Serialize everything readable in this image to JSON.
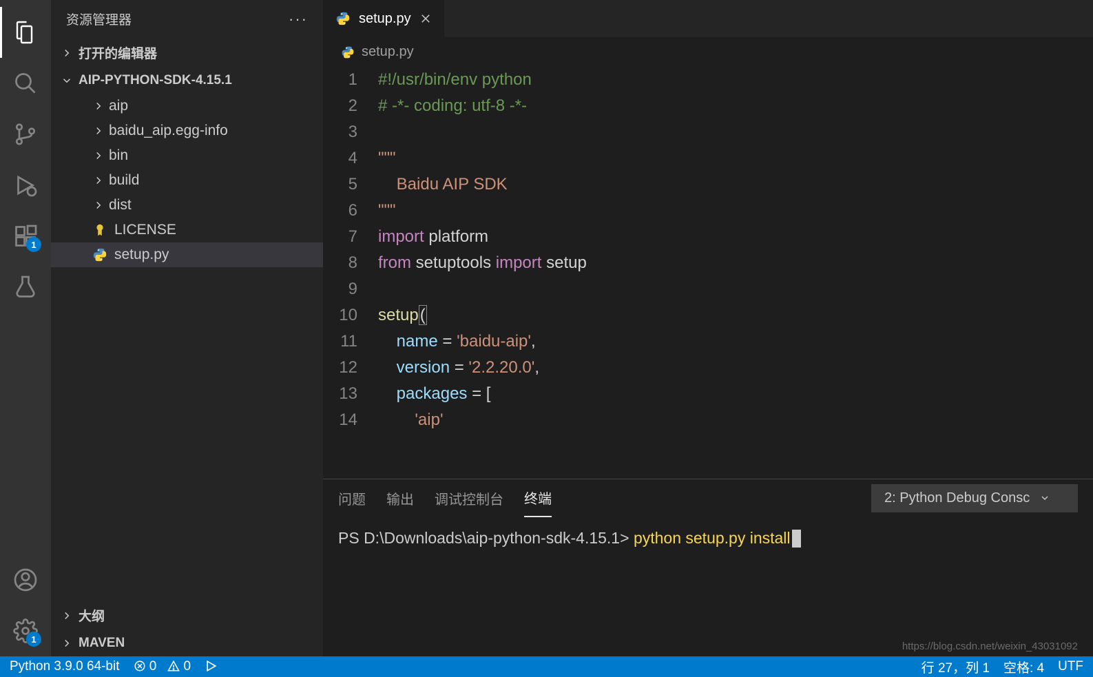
{
  "sidebar": {
    "title": "资源管理器",
    "sections": {
      "open_editors": "打开的编辑器",
      "project": "AIP-PYTHON-SDK-4.15.1",
      "outline": "大纲",
      "maven": "MAVEN"
    },
    "tree": {
      "folders": [
        "aip",
        "baidu_aip.egg-info",
        "bin",
        "build",
        "dist"
      ],
      "files": [
        {
          "name": "LICENSE",
          "icon": "license"
        },
        {
          "name": "setup.py",
          "icon": "python",
          "selected": true
        }
      ]
    }
  },
  "activity": {
    "ext_badge": "1",
    "settings_badge": "1"
  },
  "tab": {
    "name": "setup.py"
  },
  "breadcrumb": {
    "name": "setup.py"
  },
  "code": {
    "lines": [
      {
        "n": 1,
        "segs": [
          [
            "c-comment",
            "#!/usr/bin/env python"
          ]
        ]
      },
      {
        "n": 2,
        "segs": [
          [
            "c-comment",
            "# -*- coding: utf-8 -*-"
          ]
        ]
      },
      {
        "n": 3,
        "segs": []
      },
      {
        "n": 4,
        "segs": [
          [
            "c-str",
            "\"\"\""
          ]
        ]
      },
      {
        "n": 5,
        "segs": [
          [
            "c-plain",
            "    "
          ],
          [
            "c-str",
            "Baidu AIP SDK"
          ]
        ]
      },
      {
        "n": 6,
        "segs": [
          [
            "c-str",
            "\"\"\""
          ]
        ]
      },
      {
        "n": 7,
        "segs": [
          [
            "c-kw",
            "import"
          ],
          [
            "c-plain",
            " platform"
          ]
        ]
      },
      {
        "n": 8,
        "segs": [
          [
            "c-kw",
            "from"
          ],
          [
            "c-plain",
            " setuptools "
          ],
          [
            "c-kw",
            "import"
          ],
          [
            "c-plain",
            " setup"
          ]
        ]
      },
      {
        "n": 9,
        "segs": []
      },
      {
        "n": 10,
        "segs": [
          [
            "c-func",
            "setup"
          ],
          [
            "c-plain bracket-hl",
            "("
          ]
        ]
      },
      {
        "n": 11,
        "segs": [
          [
            "c-plain",
            "    "
          ],
          [
            "c-var",
            "name"
          ],
          [
            "c-plain",
            " = "
          ],
          [
            "c-str",
            "'baidu-aip'"
          ],
          [
            "c-plain",
            ","
          ]
        ]
      },
      {
        "n": 12,
        "segs": [
          [
            "c-plain",
            "    "
          ],
          [
            "c-var",
            "version"
          ],
          [
            "c-plain",
            " = "
          ],
          [
            "c-str",
            "'2.2.20.0'"
          ],
          [
            "c-plain",
            ","
          ]
        ]
      },
      {
        "n": 13,
        "segs": [
          [
            "c-plain",
            "    "
          ],
          [
            "c-var",
            "packages"
          ],
          [
            "c-plain",
            " = ["
          ]
        ]
      },
      {
        "n": 14,
        "segs": [
          [
            "c-plain",
            "        "
          ],
          [
            "c-str",
            "'aip'"
          ]
        ]
      }
    ]
  },
  "panel": {
    "tabs": {
      "problems": "问题",
      "output": "输出",
      "debug_console": "调试控制台",
      "terminal": "终端"
    },
    "dropdown": "2: Python Debug Consc",
    "terminal": {
      "prompt": "PS D:\\Downloads\\aip-python-sdk-4.15.1> ",
      "command": "python setup.py install"
    }
  },
  "status": {
    "python": "Python 3.9.0 64-bit",
    "errors": "0",
    "warnings": "0",
    "line_col": "行 27，列 1",
    "spaces": "空格: 4",
    "encoding": "UTF"
  },
  "watermark": "https://blog.csdn.net/weixin_43031092"
}
